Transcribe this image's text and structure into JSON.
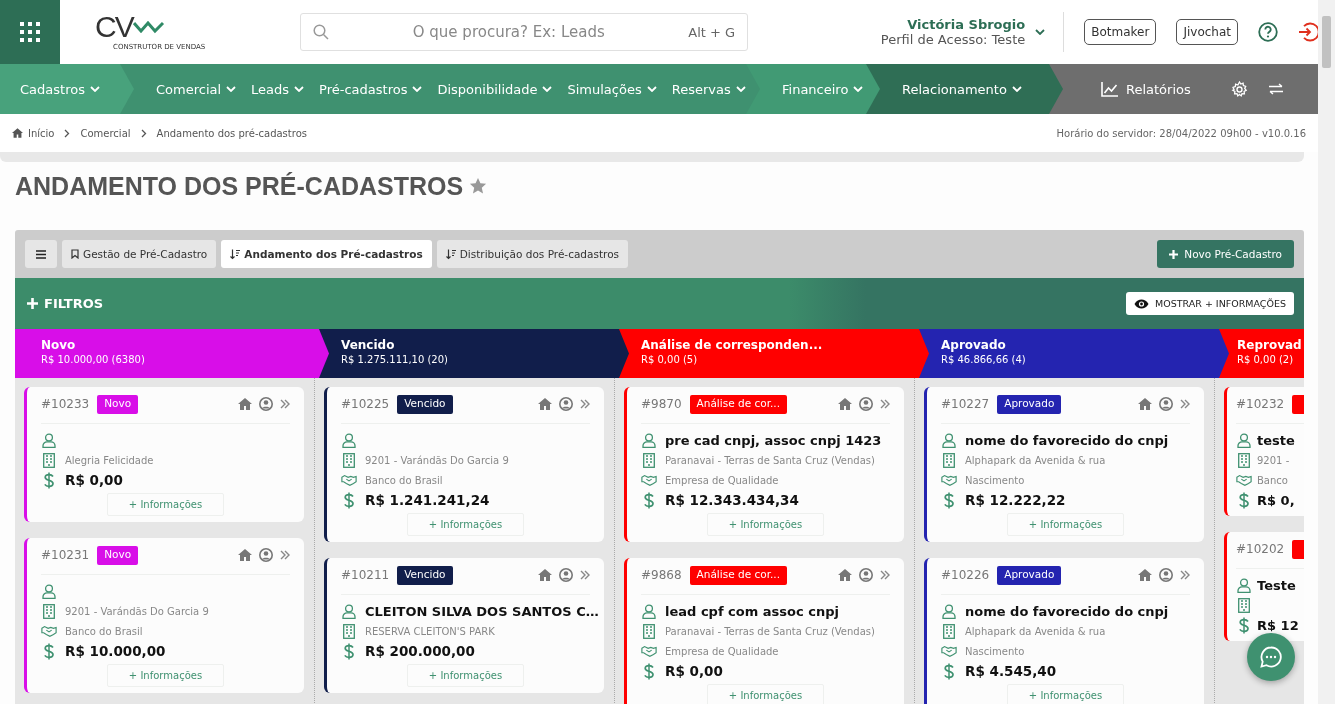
{
  "header": {
    "logo": {
      "mark": "CV",
      "caption": "CONSTRUTOR DE VENDAS"
    },
    "search": {
      "placeholder": "O que procura? Ex: Leads",
      "shortcut": "Alt + G"
    },
    "user": {
      "name": "Victória Sbrogio",
      "profile": "Perfil de Acesso: Teste"
    },
    "buttons": [
      "Botmaker",
      "Jivochat"
    ]
  },
  "nav": {
    "groups": [
      {
        "color": "#48a27c",
        "items": [
          "Cadastros"
        ]
      },
      {
        "color": "#3f9170",
        "items": [
          "Comercial",
          "Leads",
          "Pré-cadastros",
          "Disponibilidade",
          "Simulações",
          "Reservas"
        ]
      },
      {
        "color": "#419a74",
        "items": [
          "Financeiro"
        ]
      },
      {
        "color": "#2f6e55",
        "items": [
          "Relacionamento"
        ]
      }
    ],
    "reports": "Relatórios"
  },
  "breadcrumb": [
    "Início",
    "Comercial",
    "Andamento dos pré-cadastros"
  ],
  "server_time": "Horário do servidor: 28/04/2022 09h00 - v10.0.16",
  "title": "ANDAMENTO DOS PRÉ-CADASTROS",
  "tabs": [
    {
      "label": "Gestão de Pré-Cadastro",
      "kind": "bookmark",
      "selected": false
    },
    {
      "label": "Andamento dos Pré-cadastros",
      "kind": "sort",
      "selected": true
    },
    {
      "label": "Distribuição dos Pré-cadastros",
      "kind": "sort",
      "selected": false
    }
  ],
  "new_button": "Novo Pré-Cadastro",
  "filters": {
    "label": "FILTROS",
    "toggle": "MOSTRAR + INFORMAÇÕES"
  },
  "columns": [
    {
      "name": "Novo",
      "total": "R$ 10.000,00 (6380)",
      "color": "#d80ee8",
      "cards": [
        {
          "id": "#10233",
          "badge": "Novo",
          "project": "Alegria Felicidade",
          "value": "R$ 0,00",
          "more": "+ Informações"
        },
        {
          "id": "#10231",
          "badge": "Novo",
          "project": "9201 - Varándãs Do Garcia 9",
          "bank": "Banco do Brasil",
          "value": "R$ 10.000,00",
          "more": "+ Informações"
        }
      ]
    },
    {
      "name": "Vencido",
      "total": "R$ 1.275.111,10 (20)",
      "color": "#111e4b",
      "cards": [
        {
          "id": "#10225",
          "badge": "Vencido",
          "project": "9201 - Varándãs Do Garcia 9",
          "bank": "Banco do Brasil",
          "value": "R$ 1.241.241,24",
          "more": "+ Informações"
        },
        {
          "id": "#10211",
          "badge": "Vencido",
          "name": "CLEITON SILVA DOS SANTOS C…",
          "project": "RESERVA CLEITON'S PARK",
          "value": "R$ 200.000,00",
          "more": "+ Informações"
        }
      ]
    },
    {
      "name": "Análise de corresponden...",
      "total": "R$ 0,00 (5)",
      "color": "#ff0000",
      "cards": [
        {
          "id": "#9870",
          "badge": "Análise de cor...",
          "name": "pre cad cnpj, assoc cnpj 1423",
          "project": "Paranavai - Terras de Santa Cruz (Vendas)",
          "bank": "Empresa de Qualidade",
          "value": "R$ 12.343.434,34",
          "more": "+ Informações"
        },
        {
          "id": "#9868",
          "badge": "Análise de cor...",
          "name": "lead cpf com assoc cnpj",
          "project": "Paranavai - Terras de Santa Cruz (Vendas)",
          "bank": "Empresa de Qualidade",
          "value": "R$ 0,00",
          "more": "+ Informações"
        }
      ]
    },
    {
      "name": "Aprovado",
      "total": "R$ 46.866,66 (4)",
      "color": "#2424b0",
      "cards": [
        {
          "id": "#10227",
          "badge": "Aprovado",
          "name": "nome do favorecido do cnpj",
          "project": "Alphapark da Avenida & rua",
          "bank": "Nascimento",
          "value": "R$ 12.222,22",
          "more": "+ Informações"
        },
        {
          "id": "#10226",
          "badge": "Aprovado",
          "name": "nome do favorecido do cnpj",
          "project": "Alphapark da Avenida & rua",
          "bank": "Nascimento",
          "value": "R$ 4.545,40",
          "more": "+ Informações"
        }
      ]
    },
    {
      "name": "Reprovad",
      "total": "R$ 0,00 (2)",
      "color": "#fe0000",
      "cards": [
        {
          "id": "#10232",
          "name": "teste",
          "project": "9201 -",
          "bank": "Banco",
          "value": "R$ 0,"
        },
        {
          "id": "#10202",
          "name": "Teste",
          "value": "R$ 12"
        }
      ]
    }
  ]
}
